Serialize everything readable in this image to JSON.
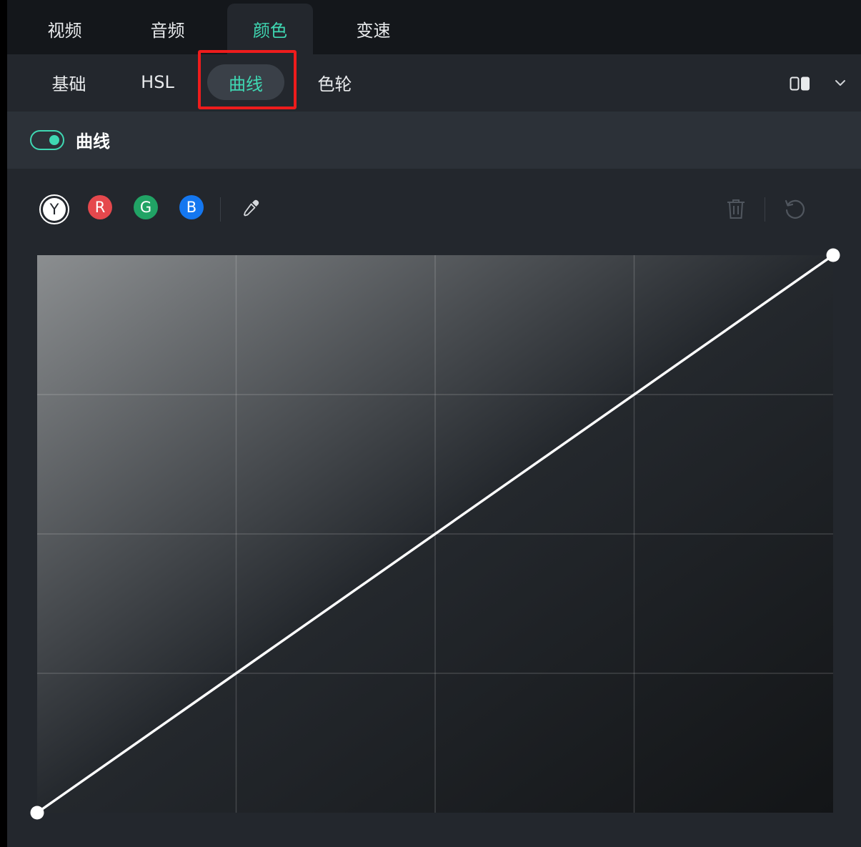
{
  "top_tabs": {
    "video": "视频",
    "audio": "音频",
    "color": "颜色",
    "speed": "变速"
  },
  "sub_tabs": {
    "basic": "基础",
    "hsl": "HSL",
    "curves": "曲线",
    "color_wheel": "色轮"
  },
  "section": {
    "title": "曲线",
    "enabled": true
  },
  "channels": {
    "y": "Y",
    "r": "R",
    "g": "G",
    "b": "B"
  },
  "colors": {
    "accent": "#3fd8b3",
    "red": "#e5484d",
    "green": "#21a365",
    "blue": "#1477f0",
    "highlight": "#ee1c1c"
  },
  "icons": {
    "eyedropper": "eyedropper-icon",
    "delete": "trash-icon",
    "reset": "reset-icon",
    "compare": "compare-view-icon",
    "expand": "chevron-down-icon"
  },
  "curve": {
    "points": [
      [
        0,
        0
      ],
      [
        1,
        1
      ]
    ]
  }
}
